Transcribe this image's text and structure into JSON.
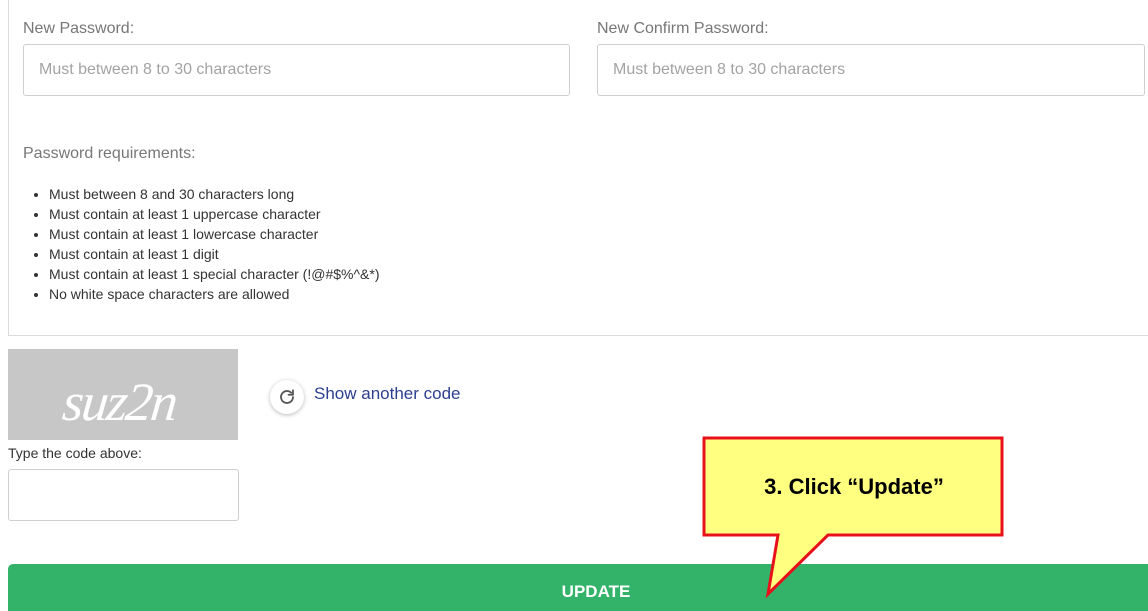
{
  "form": {
    "new_password": {
      "label": "New Password:",
      "placeholder": "Must between 8 to 30 characters",
      "value": ""
    },
    "confirm_password": {
      "label": "New Confirm Password:",
      "placeholder": "Must between 8 to 30 characters",
      "value": ""
    },
    "requirements": {
      "title": "Password requirements:",
      "items": [
        "Must between 8 and 30 characters long",
        "Must contain at least 1 uppercase character",
        "Must contain at least 1 lowercase character",
        "Must contain at least 1 digit",
        "Must contain at least 1 special character (!@#$%^&*)",
        "No white space characters are allowed"
      ]
    }
  },
  "captcha": {
    "image_text": "suz2n",
    "refresh_icon": "refresh-icon",
    "show_another_label": "Show another code",
    "code_label": "Type the code above:",
    "code_value": ""
  },
  "actions": {
    "update_label": "UPDATE"
  },
  "annotation": {
    "callout_text": "3. Click “Update”"
  },
  "colors": {
    "primary_button": "#33b369",
    "link": "#2b3f8f",
    "callout_fill": "#ffff80",
    "callout_border": "#e8101a"
  }
}
